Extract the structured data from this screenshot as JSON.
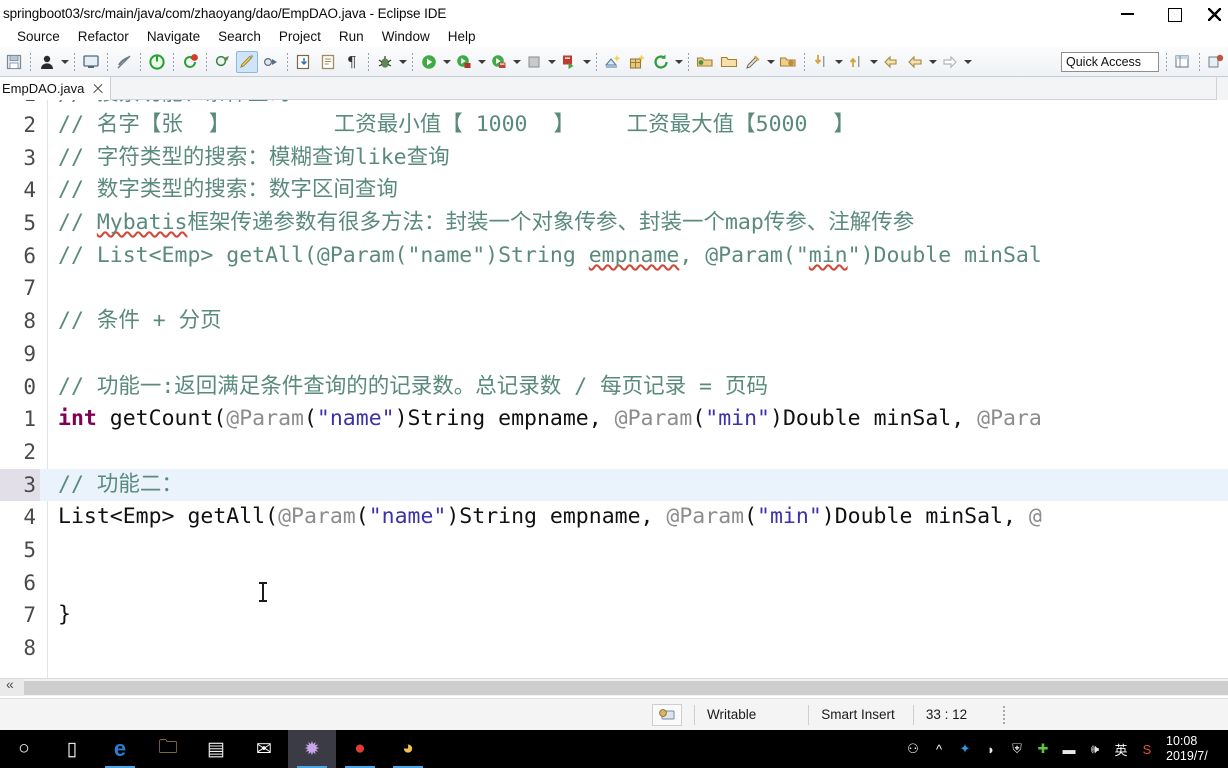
{
  "window": {
    "title": "springboot03/src/main/java/com/zhaoyang/dao/EmpDAO.java - Eclipse IDE",
    "minimize_label": "Minimize",
    "maximize_label": "Maximize",
    "close_label": "Close"
  },
  "menu": {
    "items": [
      "Source",
      "Refactor",
      "Navigate",
      "Search",
      "Project",
      "Run",
      "Window",
      "Help"
    ]
  },
  "toolbar": {
    "quick_access_label": "Quick Access",
    "icons": [
      "save-icon",
      "person-icon",
      "terminal-icon",
      "no-link-icon",
      "power-icon",
      "refresh-cycle-icon",
      "annotation-icon",
      "highlight-pen-icon",
      "next-annotation-icon",
      "export-icon",
      "document-icon",
      "paragraph-icon",
      "debug-bug-icon",
      "run-icon",
      "run-green-icon",
      "coverage-icon",
      "stop-icon",
      "run-last-icon",
      "new-class-icon",
      "new-package-icon",
      "refresh-icon",
      "open-folder-icon",
      "folder-icon",
      "rocket-icon",
      "folder-alt-icon",
      "step-into-icon",
      "step-out-icon",
      "back-arrow-icon",
      "back-icon",
      "forward-icon"
    ]
  },
  "tab": {
    "label": "EmpDAO.java",
    "close_label": "Close tab"
  },
  "editor": {
    "first_line_clipped": true,
    "current_line": 13,
    "lines": [
      {
        "no": "1",
        "tokens": [
          {
            "t": "// 搜索功能、条件查询",
            "c": "cmt"
          }
        ]
      },
      {
        "no": "2",
        "tokens": [
          {
            "t": "// 名字【张  】        工资最小值【 1000  】    工资最大值【5000  】",
            "c": "cmt"
          }
        ]
      },
      {
        "no": "3",
        "tokens": [
          {
            "t": "// 字符类型的搜索：模糊查询like查询",
            "c": "cmt"
          }
        ]
      },
      {
        "no": "4",
        "tokens": [
          {
            "t": "// 数字类型的搜索：数字区间查询",
            "c": "cmt"
          }
        ]
      },
      {
        "no": "5",
        "tokens": [
          {
            "t": "// ",
            "c": "cmt"
          },
          {
            "t": "Mybatis",
            "c": "cmt sq"
          },
          {
            "t": "框架传递参数有很多方法：封装一个对象传参、封装一个map传参、注解传参",
            "c": "cmt"
          }
        ]
      },
      {
        "no": "6",
        "tokens": [
          {
            "t": "// List<Emp> getAll(@Param(\"name\")String ",
            "c": "cmt"
          },
          {
            "t": "empname",
            "c": "cmt sq"
          },
          {
            "t": ", @Param(\"",
            "c": "cmt"
          },
          {
            "t": "min",
            "c": "cmt sq"
          },
          {
            "t": "\")Double minSal",
            "c": "cmt"
          }
        ]
      },
      {
        "no": "7",
        "tokens": []
      },
      {
        "no": "8",
        "tokens": [
          {
            "t": "// 条件 + 分页",
            "c": "cmt"
          }
        ]
      },
      {
        "no": "9",
        "tokens": []
      },
      {
        "no": "0",
        "tokens": [
          {
            "t": "// 功能一:返回满足条件查询的的记录数。总记录数 / 每页记录 = 页码",
            "c": "cmt"
          }
        ]
      },
      {
        "no": "1",
        "tokens": [
          {
            "t": "int",
            "c": "kw"
          },
          {
            "t": " getCount(",
            "c": "plain"
          },
          {
            "t": "@Param",
            "c": "ann"
          },
          {
            "t": "(",
            "c": "plain"
          },
          {
            "t": "\"name\"",
            "c": "str"
          },
          {
            "t": ")String empname, ",
            "c": "plain"
          },
          {
            "t": "@Param",
            "c": "ann"
          },
          {
            "t": "(",
            "c": "plain"
          },
          {
            "t": "\"min\"",
            "c": "str"
          },
          {
            "t": ")Double minSal, ",
            "c": "plain"
          },
          {
            "t": "@Para",
            "c": "ann"
          }
        ]
      },
      {
        "no": "2",
        "tokens": []
      },
      {
        "no": "3",
        "tokens": [
          {
            "t": "// 功能二：",
            "c": "cmt"
          }
        ]
      },
      {
        "no": "4",
        "tokens": [
          {
            "t": "List<Emp> getAll(",
            "c": "plain"
          },
          {
            "t": "@Param",
            "c": "ann"
          },
          {
            "t": "(",
            "c": "plain"
          },
          {
            "t": "\"name\"",
            "c": "str"
          },
          {
            "t": ")String empname, ",
            "c": "plain"
          },
          {
            "t": "@Param",
            "c": "ann"
          },
          {
            "t": "(",
            "c": "plain"
          },
          {
            "t": "\"min\"",
            "c": "str"
          },
          {
            "t": ")Double minSal, ",
            "c": "plain"
          },
          {
            "t": "@",
            "c": "ann"
          }
        ]
      },
      {
        "no": "5",
        "tokens": []
      },
      {
        "no": "6",
        "tokens": []
      },
      {
        "no": "7",
        "tokens": [
          {
            "t": "}",
            "c": "plain"
          }
        ]
      },
      {
        "no": "8",
        "tokens": []
      }
    ]
  },
  "statusbar": {
    "writable": "Writable",
    "insert_mode": "Smart Insert",
    "cursor_position": "33 : 12"
  },
  "taskbar": {
    "items": [
      {
        "name": "cortana-icon",
        "glyph": "○",
        "running": false,
        "focused": false
      },
      {
        "name": "task-view-icon",
        "glyph": "▯",
        "running": false,
        "focused": false
      },
      {
        "name": "edge-browser-icon",
        "glyph": "e",
        "running": true,
        "focused": false
      },
      {
        "name": "file-explorer-icon",
        "glyph": "🗀",
        "running": false,
        "focused": false
      },
      {
        "name": "microsoft-store-icon",
        "glyph": "▤",
        "running": false,
        "focused": false
      },
      {
        "name": "mail-icon",
        "glyph": "✉",
        "running": false,
        "focused": false
      },
      {
        "name": "eclipse-ide-icon",
        "glyph": "✹",
        "running": true,
        "focused": true
      },
      {
        "name": "screen-recorder-icon",
        "glyph": "●",
        "running": true,
        "focused": false
      },
      {
        "name": "navicat-icon",
        "glyph": "◕",
        "running": true,
        "focused": false
      }
    ],
    "tray": [
      {
        "name": "people-icon",
        "glyph": "⚇"
      },
      {
        "name": "show-hidden-icons-chevron",
        "glyph": "^"
      },
      {
        "name": "bluetooth-icon",
        "glyph": "✦"
      },
      {
        "name": "wifi-icon",
        "glyph": "◗"
      },
      {
        "name": "windows-defender-icon",
        "glyph": "⛨"
      },
      {
        "name": "green-plus-icon",
        "glyph": "✚"
      },
      {
        "name": "battery-icon",
        "glyph": "▬"
      },
      {
        "name": "volume-icon",
        "glyph": "🕪"
      },
      {
        "name": "ime-language-icon",
        "glyph": "英"
      },
      {
        "name": "sogou-input-icon",
        "glyph": "S"
      }
    ],
    "clock_time": "10:08",
    "clock_date": "2019/7/"
  }
}
